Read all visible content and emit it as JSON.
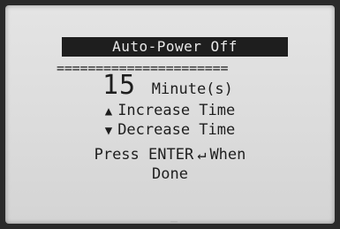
{
  "screen": {
    "title": "Auto-Power Off",
    "divider": "======================",
    "value": "15",
    "unit": "Minute(s)",
    "increase_glyph": "▲",
    "increase_label": "Increase Time",
    "decrease_glyph": "▼",
    "decrease_label": "Decrease Time",
    "prompt_before": "Press ENTER",
    "enter_glyph": "↵",
    "prompt_after": "When",
    "prompt_line2": "Done"
  }
}
